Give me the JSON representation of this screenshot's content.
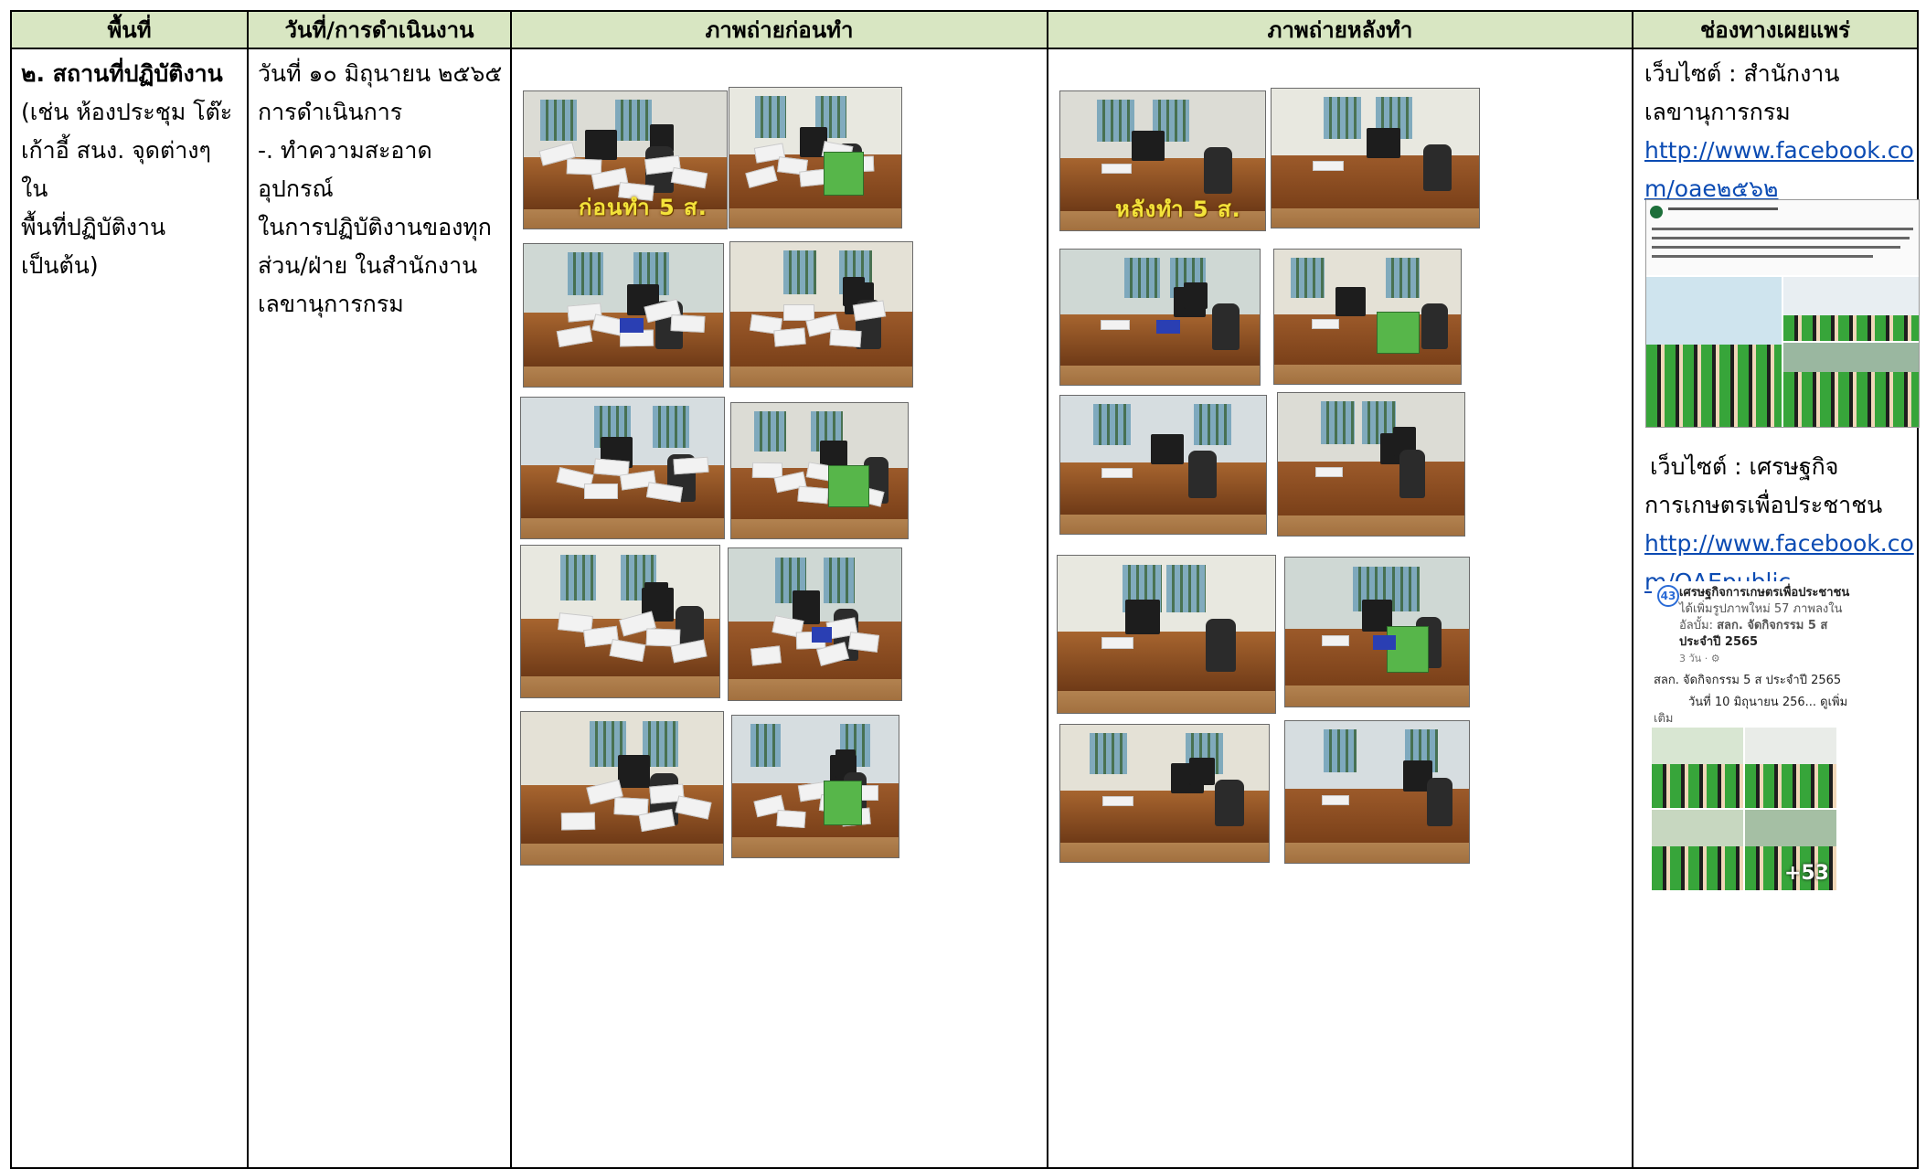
{
  "headers": {
    "area": "พื้นที่",
    "date": "วันที่/การดำเนินงาน",
    "before": "ภาพถ่ายก่อนทำ",
    "after": "ภาพถ่ายหลังทำ",
    "channel": "ช่องทางเผยแพร่"
  },
  "row": {
    "area_title": "๒. สถานที่ปฏิบัติงาน",
    "area_lines": [
      "(เช่น ห้องประชุม โต๊ะ",
      "เก้าอี้ สนง. จุดต่างๆ ใน",
      "พื้นที่ปฏิบัติงาน",
      "เป็นต้น)"
    ],
    "date_lines": [
      "วันที่ ๑๐ มิถุนายน ๒๕๖๕",
      "การดำเนินการ",
      "-. ทำความสะอาดอุปกรณ์",
      "ในการปฏิบัติงานของทุก",
      "ส่วน/ฝ่าย ในสำนักงาน",
      "เลขานุการกรม"
    ],
    "before_caption": "ก่อนทำ 5 ส.",
    "after_caption": "หลังทำ 5 ส.",
    "channel1": {
      "label_lines": [
        "เว็บไซต์ : สำนักงาน",
        "เลขานุการกรม"
      ],
      "url_lines": [
        "http://www.facebook.co",
        "m/oae๒๕๖๒"
      ]
    },
    "channel2": {
      "label_lines": [
        "เว็บไซต์ : เศรษฐกิจ",
        "การเกษตรเพื่อประชาชน"
      ],
      "url_lines": [
        "http://www.facebook.co",
        "m/OAEpublic"
      ],
      "post": {
        "page_name": "เศรษฐกิจการเกษตรเพื่อประชาชน",
        "line1": "ได้เพิ่มรูปภาพใหม่ 57 ภาพลงใน",
        "line2_prefix": "อัลบั้ม: ",
        "album": "สลก. จัดกิจกรรม 5 ส",
        "album2": "ประจำปี 2565",
        "time": "3 วัน · ",
        "body1": "สลก. จัดกิจกรรม 5 ส ประจำปี 2565",
        "body2": "วันที่ 10 มิถุนายน 256... ดูเพิ่ม",
        "body3": "เติม",
        "more_count": "+53"
      }
    }
  }
}
